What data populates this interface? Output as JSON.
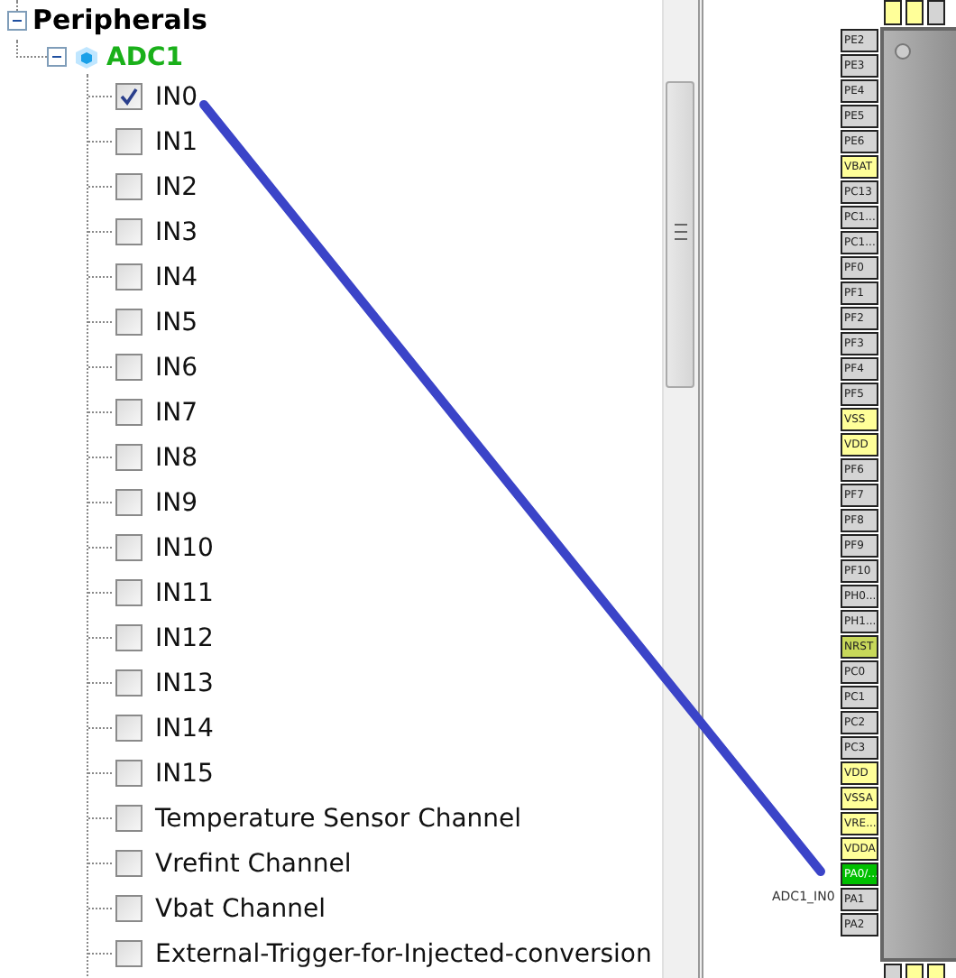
{
  "tree": {
    "label": "Peripherals",
    "expanded": true,
    "children": [
      {
        "label": "ADC1",
        "expanded": true,
        "children": [
          {
            "label": "IN0",
            "checked": true
          },
          {
            "label": "IN1",
            "checked": false
          },
          {
            "label": "IN2",
            "checked": false
          },
          {
            "label": "IN3",
            "checked": false
          },
          {
            "label": "IN4",
            "checked": false
          },
          {
            "label": "IN5",
            "checked": false
          },
          {
            "label": "IN6",
            "checked": false
          },
          {
            "label": "IN7",
            "checked": false
          },
          {
            "label": "IN8",
            "checked": false
          },
          {
            "label": "IN9",
            "checked": false
          },
          {
            "label": "IN10",
            "checked": false
          },
          {
            "label": "IN11",
            "checked": false
          },
          {
            "label": "IN12",
            "checked": false
          },
          {
            "label": "IN13",
            "checked": false
          },
          {
            "label": "IN14",
            "checked": false
          },
          {
            "label": "IN15",
            "checked": false
          },
          {
            "label": "Temperature Sensor Channel",
            "checked": false
          },
          {
            "label": "Vrefint Channel",
            "checked": false
          },
          {
            "label": "Vbat Channel",
            "checked": false
          },
          {
            "label": "External-Trigger-for-Injected-conversion",
            "checked": false
          }
        ]
      }
    ]
  },
  "chip": {
    "signal_label": "ADC1_IN0",
    "pins": [
      {
        "label": "PE2",
        "color": "#d4d4d4"
      },
      {
        "label": "PE3",
        "color": "#d4d4d4"
      },
      {
        "label": "PE4",
        "color": "#d4d4d4"
      },
      {
        "label": "PE5",
        "color": "#d4d4d4"
      },
      {
        "label": "PE6",
        "color": "#d4d4d4"
      },
      {
        "label": "VBAT",
        "color": "#ffff99"
      },
      {
        "label": "PC13",
        "color": "#d4d4d4"
      },
      {
        "label": "PC1...",
        "color": "#d4d4d4"
      },
      {
        "label": "PC1...",
        "color": "#d4d4d4"
      },
      {
        "label": "PF0",
        "color": "#d4d4d4"
      },
      {
        "label": "PF1",
        "color": "#d4d4d4"
      },
      {
        "label": "PF2",
        "color": "#d4d4d4"
      },
      {
        "label": "PF3",
        "color": "#d4d4d4"
      },
      {
        "label": "PF4",
        "color": "#d4d4d4"
      },
      {
        "label": "PF5",
        "color": "#d4d4d4"
      },
      {
        "label": "VSS",
        "color": "#ffff99"
      },
      {
        "label": "VDD",
        "color": "#ffff99"
      },
      {
        "label": "PF6",
        "color": "#d4d4d4"
      },
      {
        "label": "PF7",
        "color": "#d4d4d4"
      },
      {
        "label": "PF8",
        "color": "#d4d4d4"
      },
      {
        "label": "PF9",
        "color": "#d4d4d4"
      },
      {
        "label": "PF10",
        "color": "#d4d4d4"
      },
      {
        "label": "PH0...",
        "color": "#d4d4d4"
      },
      {
        "label": "PH1...",
        "color": "#d4d4d4"
      },
      {
        "label": "NRST",
        "color": "#c8d85a"
      },
      {
        "label": "PC0",
        "color": "#d4d4d4"
      },
      {
        "label": "PC1",
        "color": "#d4d4d4"
      },
      {
        "label": "PC2",
        "color": "#d4d4d4"
      },
      {
        "label": "PC3",
        "color": "#d4d4d4"
      },
      {
        "label": "VDD",
        "color": "#ffff99"
      },
      {
        "label": "VSSA",
        "color": "#ffff99"
      },
      {
        "label": "VRE...",
        "color": "#ffff99"
      },
      {
        "label": "VDDA",
        "color": "#ffff99"
      },
      {
        "label": "PA0/...",
        "color": "#00c000"
      },
      {
        "label": "PA1",
        "color": "#d4d4d4"
      },
      {
        "label": "PA2",
        "color": "#d4d4d4"
      }
    ]
  }
}
